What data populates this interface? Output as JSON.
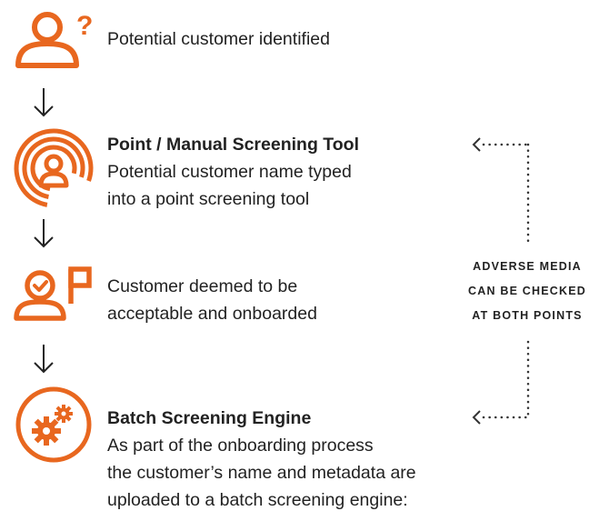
{
  "colors": {
    "accent": "#E8671F",
    "text": "#222222",
    "connector": "#333333"
  },
  "steps": [
    {
      "icon": "person-question-icon",
      "title": "",
      "lines": [
        "Potential customer identified"
      ]
    },
    {
      "icon": "person-broadcast-icon",
      "title": "Point / Manual Screening Tool",
      "lines": [
        "Potential customer name typed",
        "into a point screening tool"
      ]
    },
    {
      "icon": "person-check-flag-icon",
      "title": "",
      "lines": [
        "Customer deemed to be",
        "acceptable and onboarded"
      ]
    },
    {
      "icon": "gears-icon",
      "title": "Batch Screening Engine",
      "lines": [
        "As part of the onboarding process",
        "the customer’s name and metadata are",
        "uploaded to a batch screening engine:"
      ]
    }
  ],
  "side_note": {
    "lines": [
      "ADVERSE MEDIA",
      "CAN BE CHECKED",
      "AT BOTH POINTS"
    ]
  }
}
